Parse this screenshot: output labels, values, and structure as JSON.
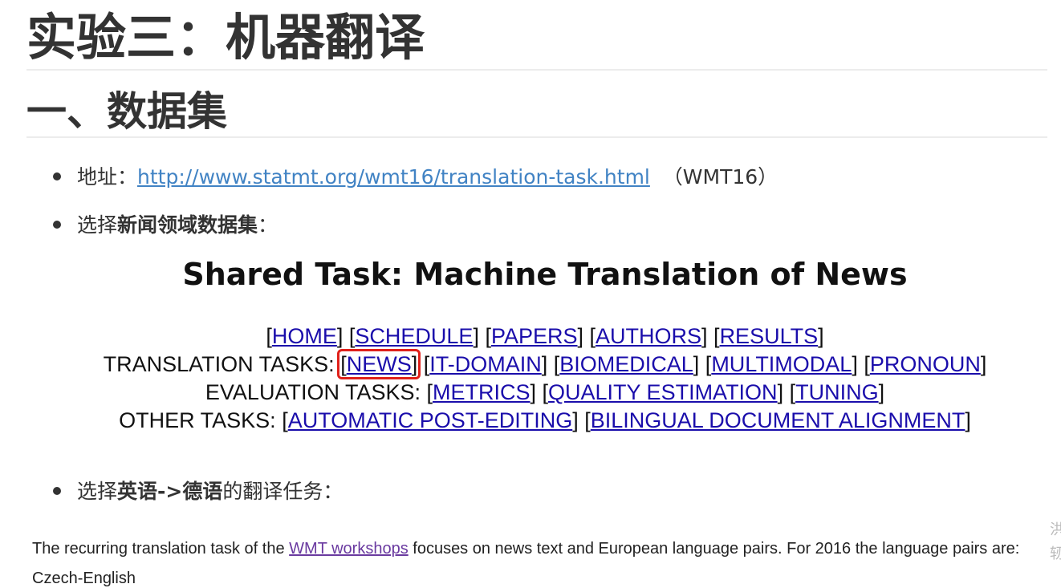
{
  "doc": {
    "h1": "实验三：机器翻译",
    "h2": "一、数据集",
    "bullet1": {
      "prefix": "地址：",
      "link": "http://www.statmt.org/wmt16/translation-task.html",
      "suffix": "（WMT16）"
    },
    "bullet2": {
      "prefix": "选择",
      "bold": "新闻领域数据集",
      "suffix": "："
    },
    "bullet3": {
      "prefix": "选择",
      "bold": "英语->德语",
      "suffix": "的翻译任务："
    }
  },
  "screenshot": {
    "title": "Shared Task: Machine Translation of News",
    "row1": {
      "links": [
        "HOME",
        "SCHEDULE",
        "PAPERS",
        "AUTHORS",
        "RESULTS"
      ]
    },
    "row2": {
      "label": "TRANSLATION TASKS: ",
      "links": [
        "NEWS",
        "IT-DOMAIN",
        "BIOMEDICAL",
        "MULTIMODAL",
        "PRONOUN"
      ]
    },
    "row3": {
      "label": "EVALUATION TASKS: ",
      "links": [
        "METRICS",
        "QUALITY ESTIMATION",
        "TUNING"
      ]
    },
    "row4": {
      "label": "OTHER TASKS: ",
      "links": [
        "AUTOMATIC POST-EDITING",
        "BILINGUAL DOCUMENT ALIGNMENT"
      ]
    },
    "highlight_color": "#e0201a"
  },
  "paragraph": {
    "before": "The recurring translation task of the ",
    "link": "WMT workshops",
    "after": " focuses on news text and European language pairs. For 2016 the language pairs are:",
    "next_item": "Czech-English"
  },
  "edge": {
    "glyph1": "洪",
    "glyph2": "轫"
  },
  "colors": {
    "doc_link": "#4183c4",
    "nav_link": "#1a0dab",
    "visited_link": "#6a3aa0"
  }
}
